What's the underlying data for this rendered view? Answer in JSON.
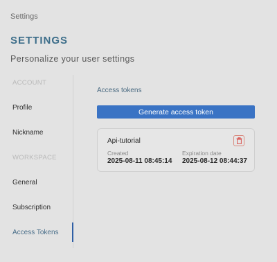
{
  "window": {
    "title": "Settings"
  },
  "header": {
    "title": "SETTINGS",
    "subtitle": "Personalize your user settings"
  },
  "sidebar": {
    "sections": [
      {
        "label": "ACCOUNT",
        "items": [
          {
            "label": "Profile"
          },
          {
            "label": "Nickname"
          }
        ]
      },
      {
        "label": "WORKSPACE",
        "items": [
          {
            "label": "General"
          },
          {
            "label": "Subscription"
          },
          {
            "label": "Access Tokens",
            "active": true
          }
        ]
      }
    ]
  },
  "main": {
    "title": "Access tokens",
    "generate_button": "Generate access token",
    "tokens": [
      {
        "name": "Api-tutorial",
        "created_label": "Created",
        "created": "2025-08-11 08:45:14",
        "expiration_label": "Expiration date",
        "expiration": "2025-08-12 08:44:37",
        "delete_icon": "trash-icon"
      }
    ]
  },
  "colors": {
    "accent": "#3a73c4",
    "brand_title": "#3d6e8a",
    "delete": "#d9534f",
    "background": "#e3e3e3"
  }
}
